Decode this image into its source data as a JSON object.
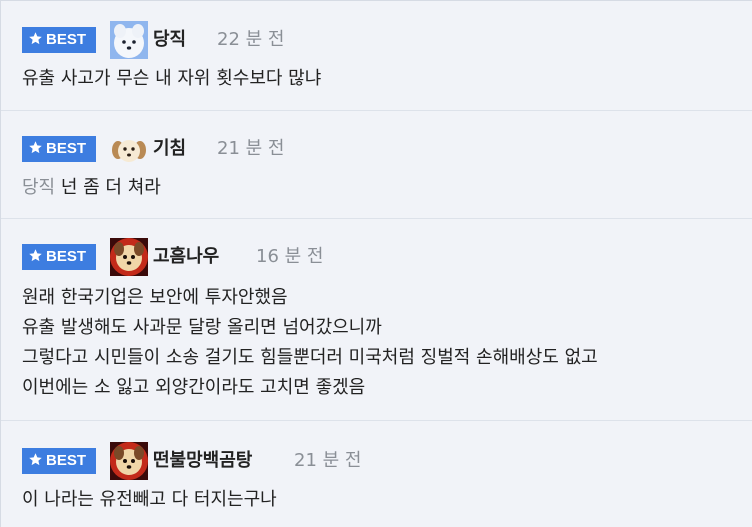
{
  "badge_label": "BEST",
  "comments": [
    {
      "nick": "당직",
      "time": "22 분 전",
      "avatar": "white-dog-avatar",
      "lines": [
        "유출 사고가 무슨 내 자위 횟수보다 많냐"
      ]
    },
    {
      "nick": "기침",
      "time": "21 분 전",
      "avatar": "puppy-face-avatar",
      "mention": "당직",
      "lines": [
        "넌 좀 더 쳐라"
      ]
    },
    {
      "nick": "고흠나우",
      "time": "16 분 전",
      "avatar": "dog-red-glow-avatar",
      "lines": [
        "원래 한국기업은 보안에 투자안했음",
        "유출 발생해도 사과문 달랑 올리면 넘어갔으니까",
        "그렇다고 시민들이 소송 걸기도 힘들뿐더러 미국처럼 징벌적 손해배상도 없고",
        "이번에는 소 잃고 외양간이라도 고치면 좋겠음"
      ]
    },
    {
      "nick": "떤불망백곰탕",
      "time": "21 분 전",
      "avatar": "dog-red-glow-avatar",
      "lines": [
        "이 나라는 유전빼고 다 터지는구나"
      ]
    }
  ]
}
